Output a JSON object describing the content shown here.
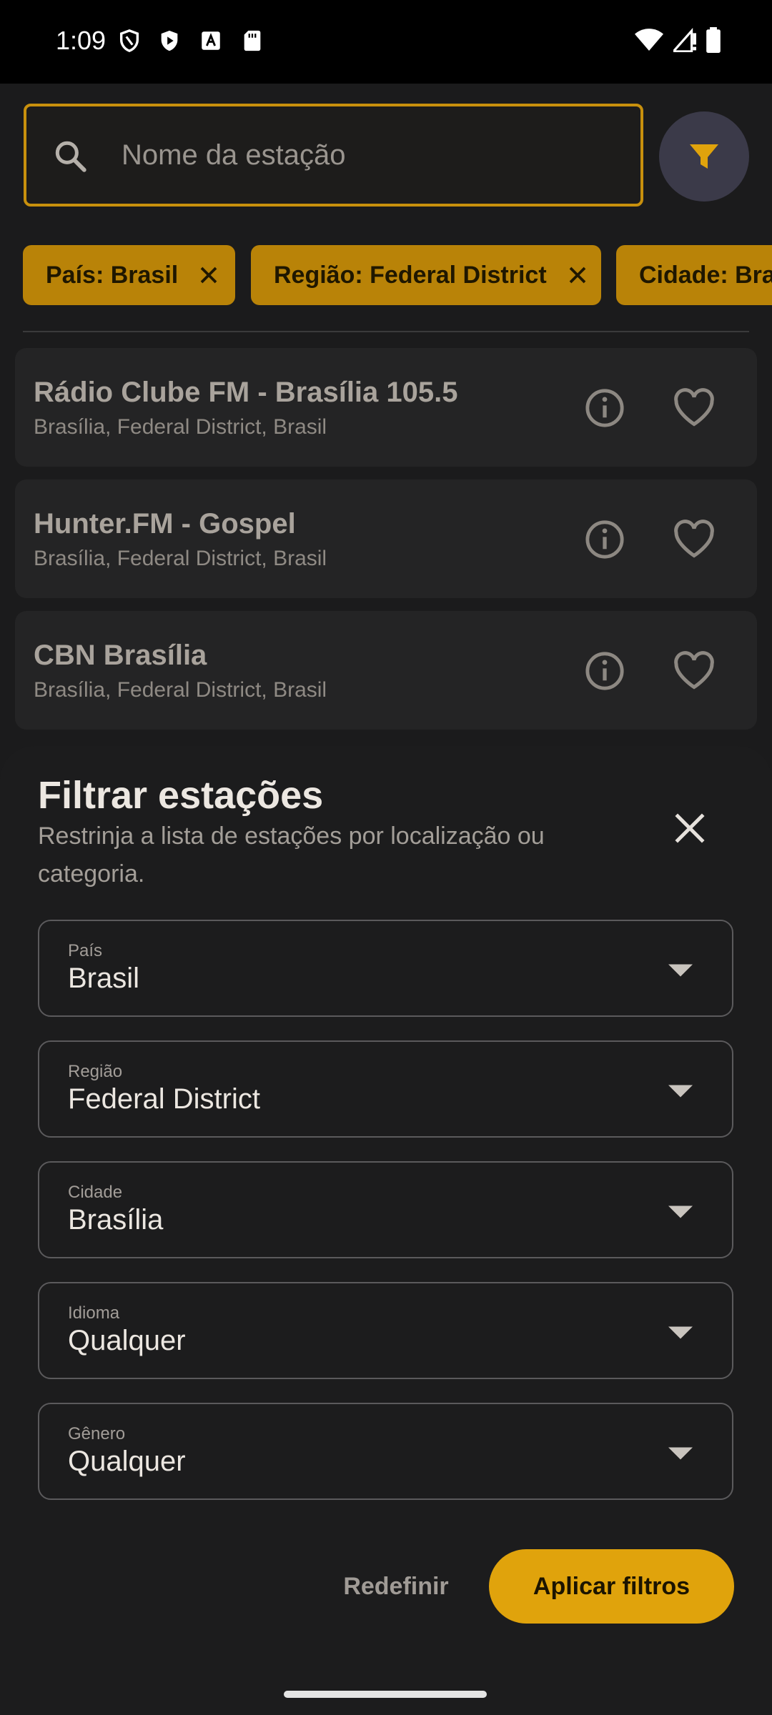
{
  "status_bar": {
    "time": "1:09",
    "icons": [
      "shield-icon",
      "play-protect-icon",
      "a-icon",
      "sd-card-icon",
      "wifi-icon",
      "signal-icon",
      "battery-icon"
    ]
  },
  "search": {
    "placeholder": "Nome da estação"
  },
  "chips": [
    {
      "label": "País: Brasil"
    },
    {
      "label": "Região: Federal District"
    },
    {
      "label": "Cidade: Brasília"
    }
  ],
  "stations": [
    {
      "name": "Rádio Clube FM - Brasília 105.5",
      "location": "Brasília, Federal District, Brasil"
    },
    {
      "name": "Hunter.FM - Gospel",
      "location": "Brasília, Federal District, Brasil"
    },
    {
      "name": "CBN Brasília",
      "location": "Brasília, Federal District, Brasil"
    }
  ],
  "sheet": {
    "title": "Filtrar estações",
    "subtitle": "Restrinja a lista de estações por localização ou categoria.",
    "fields": [
      {
        "label": "País",
        "value": "Brasil"
      },
      {
        "label": "Região",
        "value": "Federal District"
      },
      {
        "label": "Cidade",
        "value": "Brasília"
      },
      {
        "label": "Idioma",
        "value": "Qualquer"
      },
      {
        "label": "Gênero",
        "value": "Qualquer"
      }
    ],
    "reset_label": "Redefinir",
    "apply_label": "Aplicar filtros"
  },
  "colors": {
    "accent": "#e0a30c",
    "chip": "#b98308",
    "background": "#1b1b1c"
  }
}
